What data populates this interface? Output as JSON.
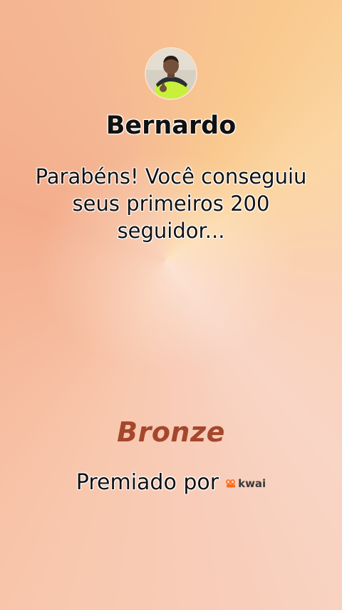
{
  "profile": {
    "name": "Bernardo",
    "avatar": "avatar-photo"
  },
  "message": {
    "text": "Parabéns! Você conseguiu seus primeiros 200 seguidor..."
  },
  "badge": {
    "level": "Bronze",
    "level_color": "#a5472c"
  },
  "footer": {
    "awarded_by": "Premiado por",
    "brand": "kwai",
    "brand_color": "#ff6a1a",
    "brand_icon": "kwai-logo-icon"
  }
}
